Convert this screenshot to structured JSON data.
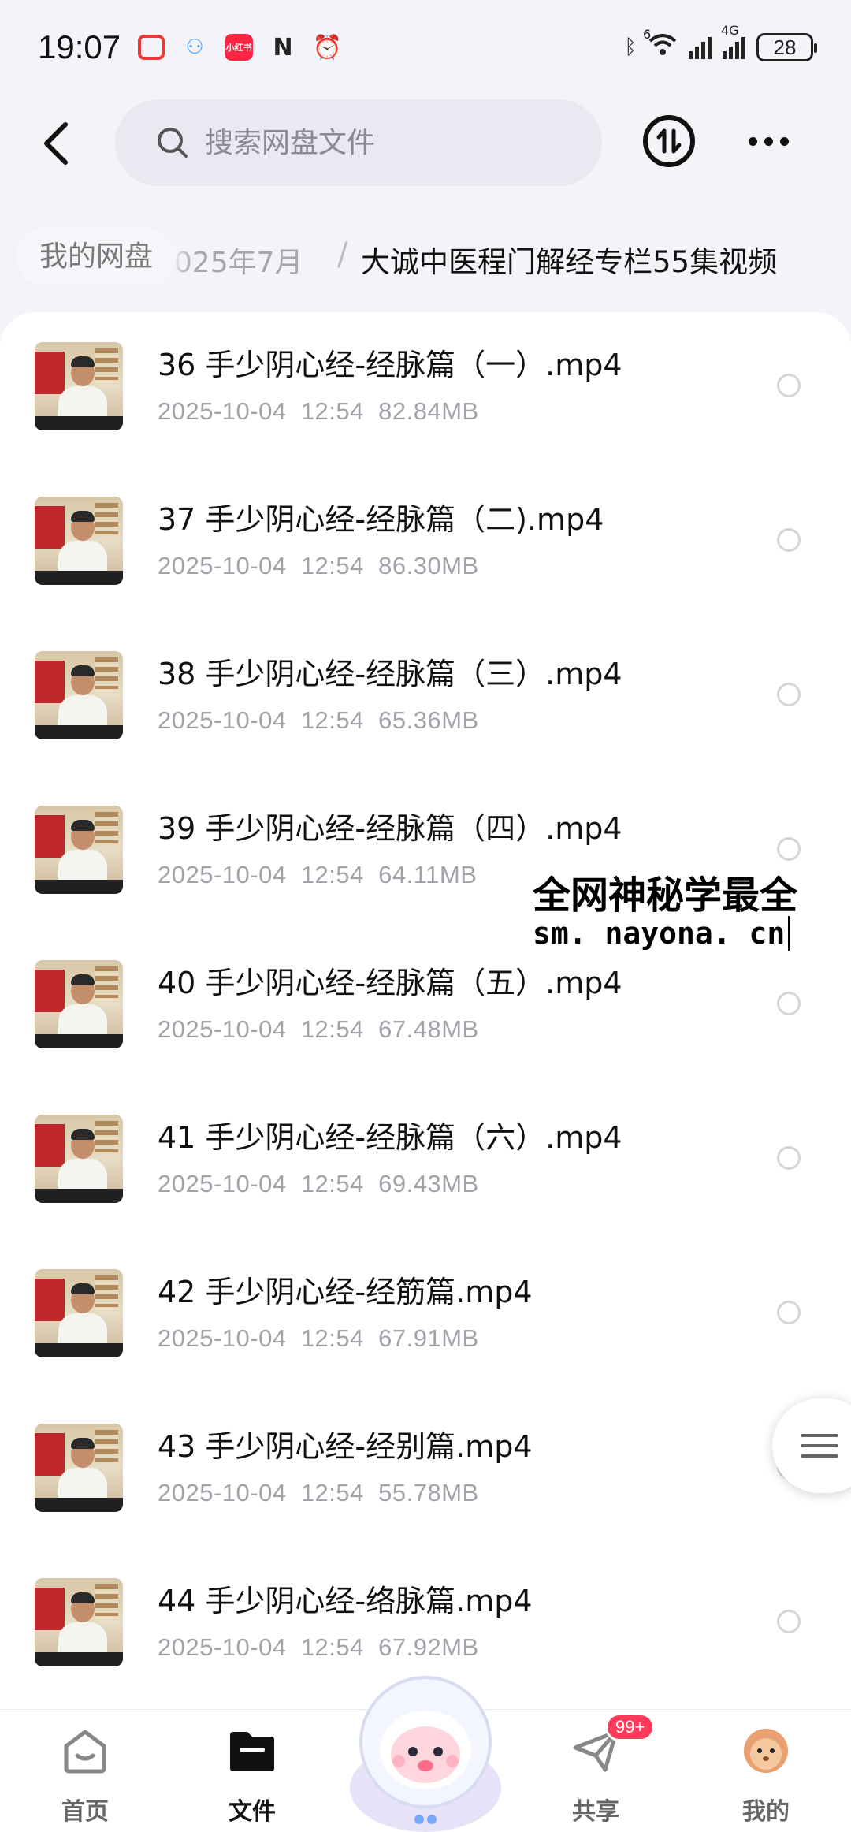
{
  "status_bar": {
    "time": "19:07",
    "app_icons": [
      "red-square-app-icon",
      "cloud-dots-app-icon",
      "xiaohongshu-app-icon",
      "nfc-icon",
      "alarm-icon"
    ],
    "xiaohongshu_label": "小红书",
    "network_label": "4G",
    "sim_label": "6",
    "battery": "28"
  },
  "header": {
    "search_placeholder": "搜索网盘文件"
  },
  "breadcrumb": {
    "root": "我的网盘",
    "parent": "2025年7月",
    "separator": "/",
    "current": "大诚中医程门解经专栏55集视频"
  },
  "files": [
    {
      "name": "36 手少阴心经-经脉篇（一）.mp4",
      "date": "2025-10-04",
      "time": "12:54",
      "size": "82.84MB"
    },
    {
      "name": "37 手少阴心经-经脉篇（二).mp4",
      "date": "2025-10-04",
      "time": "12:54",
      "size": "86.30MB"
    },
    {
      "name": "38 手少阴心经-经脉篇（三）.mp4",
      "date": "2025-10-04",
      "time": "12:54",
      "size": "65.36MB"
    },
    {
      "name": "39 手少阴心经-经脉篇（四）.mp4",
      "date": "2025-10-04",
      "time": "12:54",
      "size": "64.11MB"
    },
    {
      "name": "40 手少阴心经-经脉篇（五）.mp4",
      "date": "2025-10-04",
      "time": "12:54",
      "size": "67.48MB"
    },
    {
      "name": "41 手少阴心经-经脉篇（六）.mp4",
      "date": "2025-10-04",
      "time": "12:54",
      "size": "69.43MB"
    },
    {
      "name": "42 手少阴心经-经筋篇.mp4",
      "date": "2025-10-04",
      "time": "12:54",
      "size": "67.91MB"
    },
    {
      "name": "43 手少阴心经-经别篇.mp4",
      "date": "2025-10-04",
      "time": "12:54",
      "size": "55.78MB"
    },
    {
      "name": "44 手少阴心经-络脉篇.mp4",
      "date": "2025-10-04",
      "time": "12:54",
      "size": "67.92MB"
    }
  ],
  "watermark": {
    "line1": "全网神秘学最全",
    "line2": "sm. nayona. cn"
  },
  "bottom_nav": {
    "items": [
      {
        "label": "首页",
        "icon": "home-icon"
      },
      {
        "label": "文件",
        "icon": "folder-icon"
      },
      {
        "label": "共享",
        "icon": "paper-plane-icon"
      },
      {
        "label": "我的",
        "icon": "avatar-icon"
      }
    ],
    "share_badge": "99+"
  },
  "colors": {
    "accent_badge": "#ff3b5c",
    "background": "#f3f3f8",
    "secondary_text": "#a2a2aa"
  }
}
